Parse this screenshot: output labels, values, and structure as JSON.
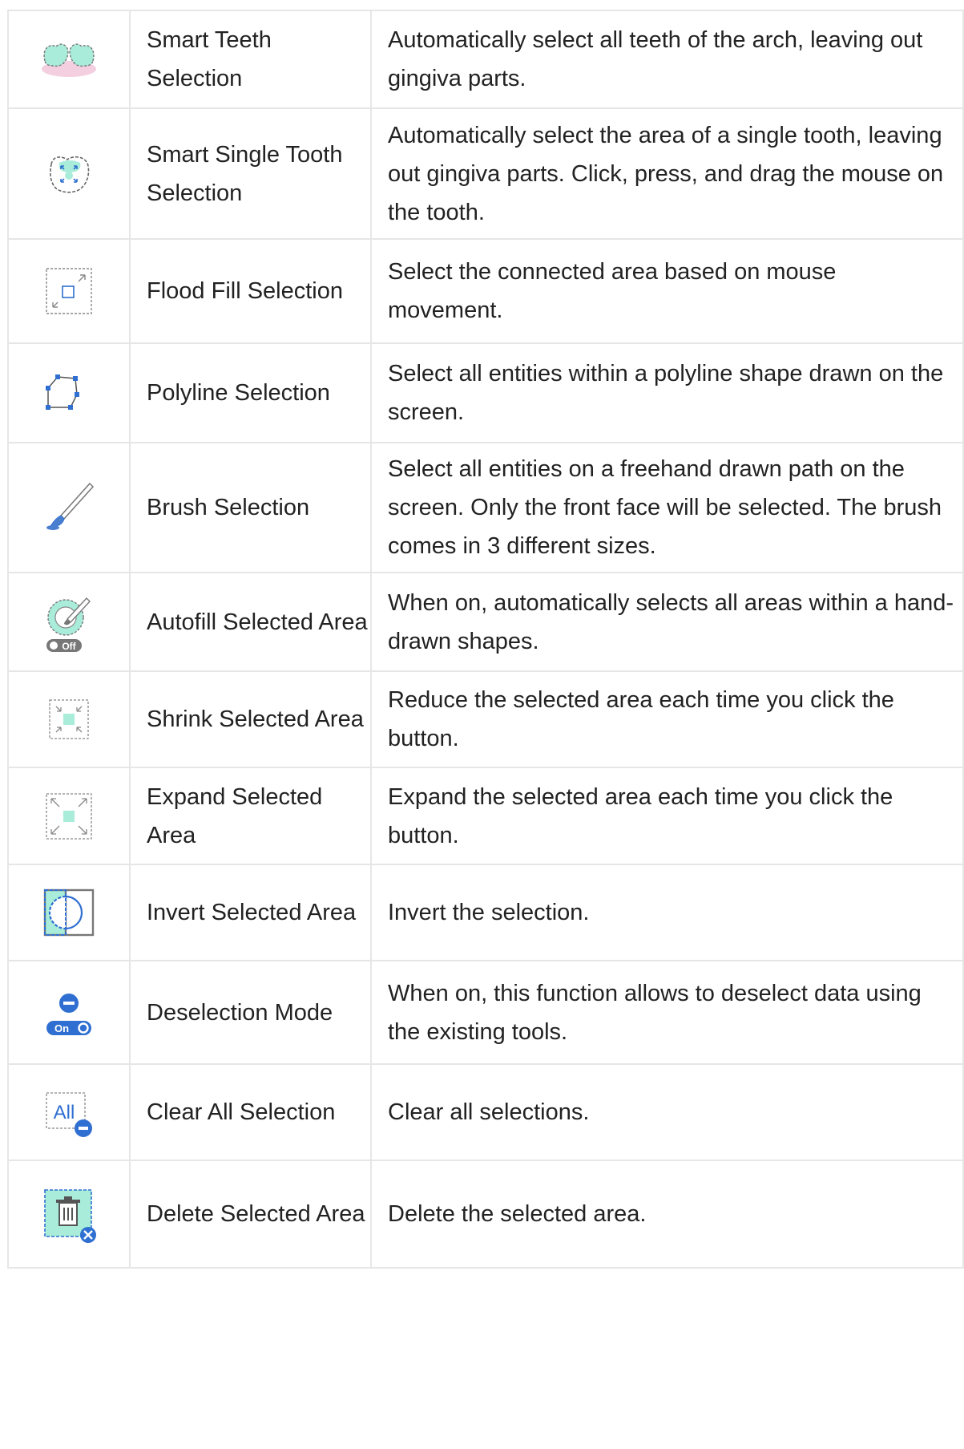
{
  "rows": [
    {
      "icon": "smart-teeth-selection-icon",
      "name": "Smart Teeth Selection",
      "description": "Automatically select all teeth of the arch, leaving out gingiva parts."
    },
    {
      "icon": "smart-single-tooth-selection-icon",
      "name": "Smart Single Tooth Selection",
      "description": "Automatically select the area of a single tooth, leaving out gingiva parts. Click, press, and drag the mouse on the tooth."
    },
    {
      "icon": "flood-fill-selection-icon",
      "name": "Flood Fill Selection",
      "description": "Select the connected area based on mouse movement."
    },
    {
      "icon": "polyline-selection-icon",
      "name": "Polyline Selection",
      "description": "Select all entities within a polyline shape drawn on the screen."
    },
    {
      "icon": "brush-selection-icon",
      "name": "Brush Selection",
      "description": "Select all entities on a freehand drawn path on the screen. Only the front face will be selected. The brush comes in 3 different sizes."
    },
    {
      "icon": "autofill-selected-area-icon",
      "name": "Autofill Selected Area",
      "description": "When on, automatically selects all areas within a hand-drawn shapes.",
      "toggle": "Off"
    },
    {
      "icon": "shrink-selected-area-icon",
      "name": "Shrink Selected Area",
      "description": "Reduce the selected area each time you click the button."
    },
    {
      "icon": "expand-selected-area-icon",
      "name": "Expand Selected Area",
      "description": "Expand the selected area each time you click the button."
    },
    {
      "icon": "invert-selected-area-icon",
      "name": "Invert Selected Area",
      "description": "Invert the selection."
    },
    {
      "icon": "deselection-mode-icon",
      "name": "Deselection Mode",
      "description": "When on, this function allows to deselect data using the existing tools.",
      "toggle": "On"
    },
    {
      "icon": "clear-all-selection-icon",
      "name": "Clear All Selection",
      "description": "Clear all selections.",
      "icon_text": "All"
    },
    {
      "icon": "delete-selected-area-icon",
      "name": "Delete Selected Area",
      "description": "Delete the selected area."
    }
  ],
  "colors": {
    "accent": "#2f6fd1",
    "mint": "#a8ecd9",
    "border": "#e6e6e6",
    "gray": "#8a8a8a"
  }
}
